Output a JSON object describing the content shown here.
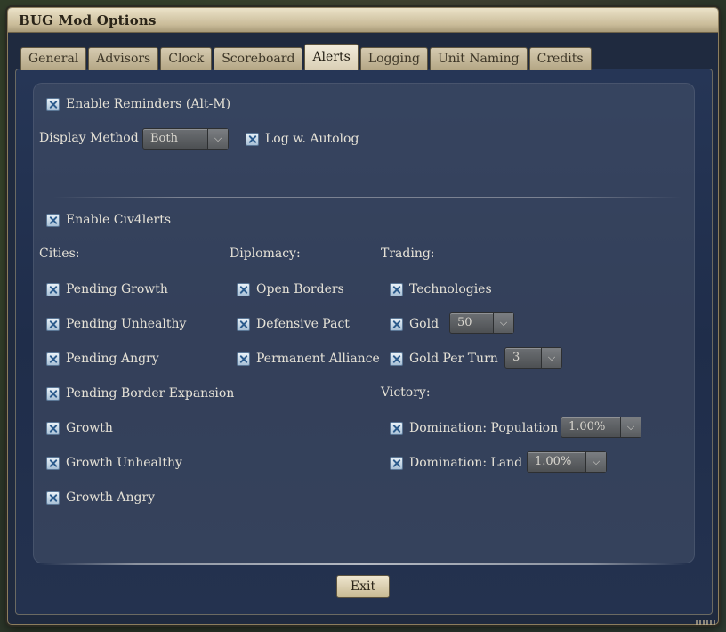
{
  "window": {
    "title": "BUG Mod Options"
  },
  "tabs": [
    {
      "label": "General",
      "active": false
    },
    {
      "label": "Advisors",
      "active": false
    },
    {
      "label": "Clock",
      "active": false
    },
    {
      "label": "Scoreboard",
      "active": false
    },
    {
      "label": "Alerts",
      "active": true
    },
    {
      "label": "Logging",
      "active": false
    },
    {
      "label": "Unit Naming",
      "active": false
    },
    {
      "label": "Credits",
      "active": false
    }
  ],
  "reminders": {
    "enable_label": "Enable Reminders (Alt-M)",
    "enable_checked": true,
    "display_method_label": "Display Method",
    "display_method_value": "Both",
    "log_label": "Log w. Autolog",
    "log_checked": true
  },
  "civ4lerts": {
    "enable_label": "Enable Civ4lerts",
    "enable_checked": true
  },
  "cities": {
    "header": "Cities:",
    "items": [
      {
        "label": "Pending Growth",
        "checked": true
      },
      {
        "label": "Pending Unhealthy",
        "checked": true
      },
      {
        "label": "Pending Angry",
        "checked": true
      },
      {
        "label": "Pending Border Expansion",
        "checked": true
      },
      {
        "label": "Growth",
        "checked": true
      },
      {
        "label": "Growth Unhealthy",
        "checked": true
      },
      {
        "label": "Growth Angry",
        "checked": true
      }
    ]
  },
  "diplomacy": {
    "header": "Diplomacy:",
    "items": [
      {
        "label": "Open Borders",
        "checked": true
      },
      {
        "label": "Defensive Pact",
        "checked": true
      },
      {
        "label": "Permanent Alliance",
        "checked": true
      }
    ]
  },
  "trading": {
    "header": "Trading:",
    "technologies_label": "Technologies",
    "gold_label": "Gold",
    "gold_value": "50",
    "gold_per_turn_label": "Gold Per Turn",
    "gold_per_turn_value": "3"
  },
  "victory": {
    "header": "Victory:",
    "population_label": "Domination: Population",
    "population_value": "1.00%",
    "land_label": "Domination: Land",
    "land_value": "1.00%"
  },
  "buttons": {
    "exit_label": "Exit"
  },
  "icons": {
    "checkbox": "checkbox-checked-icon",
    "dropdown": "chevron-down-icon"
  },
  "colors": {
    "title_bar": "#c9bb98",
    "panel_bg": "#1f2d4a",
    "text": "#e6e2d7"
  }
}
